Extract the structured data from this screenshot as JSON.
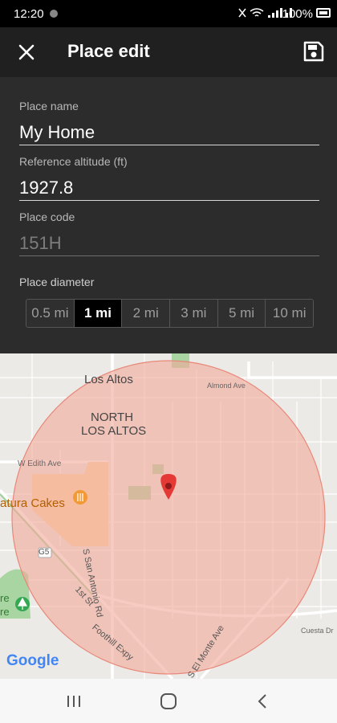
{
  "status": {
    "time": "12:20",
    "battery": "100%"
  },
  "app_bar": {
    "title": "Place edit",
    "close_icon": "close-icon",
    "save_icon": "save-icon"
  },
  "form": {
    "place_name": {
      "label": "Place name",
      "value": "My Home"
    },
    "ref_altitude": {
      "label": "Reference altitude (ft)",
      "value": "1927.8"
    },
    "place_code": {
      "label": "Place code",
      "value": "151H"
    },
    "diameter": {
      "label": "Place diameter",
      "options": [
        "0.5 mi",
        "1 mi",
        "2 mi",
        "3 mi",
        "5 mi",
        "10 mi"
      ],
      "selected": "1 mi"
    }
  },
  "map": {
    "labels": {
      "los_altos": "Los Altos",
      "north_los_altos_1": "NORTH",
      "north_los_altos_2": "LOS ALTOS",
      "almond_ave": "Almond Ave",
      "edith_ave": "W Edith Ave",
      "fatura_cakes": "atura Cakes",
      "san_antonio": "S San Antonio Rd",
      "g5": "G5",
      "first_st": "1st St",
      "foothill": "Foothill Expy",
      "el_monte": "S El Monte Ave",
      "cuesta": "Cuesta Dr",
      "left_re_1": "re",
      "left_re_2": "re",
      "google": "Google"
    },
    "circle_color": "#f3a99a",
    "marker_color": "#e53935"
  },
  "nav": {
    "recents_icon": "recents-icon",
    "home_icon": "home-icon",
    "back_icon": "back-icon"
  }
}
